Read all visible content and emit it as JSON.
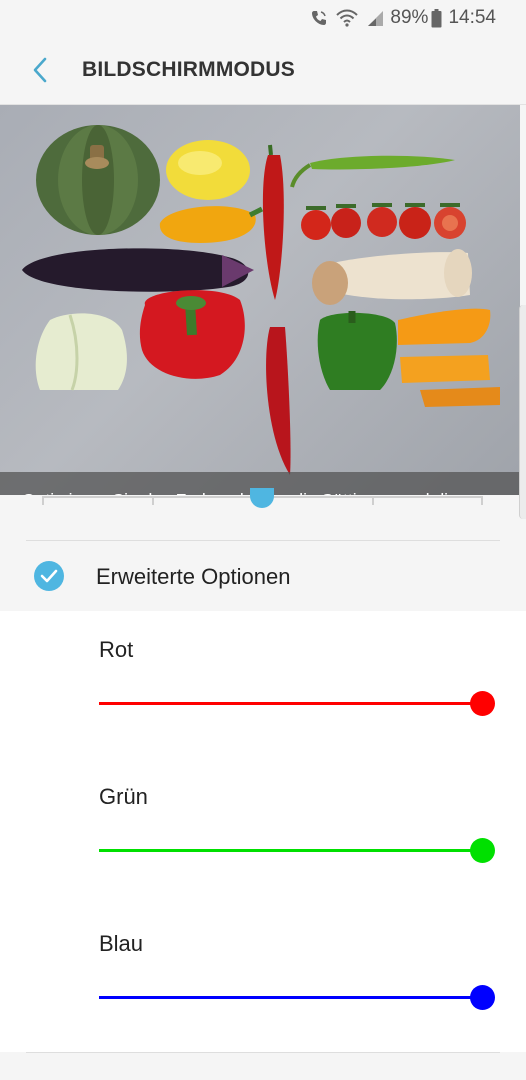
{
  "status_bar": {
    "battery": "89%",
    "time": "14:54",
    "icons": [
      "call-icon",
      "wifi-icon",
      "signal-icon",
      "battery-icon"
    ]
  },
  "header": {
    "title": "BILDSCHIRMMODUS",
    "back_icon": "chevron-left-icon"
  },
  "preview": {
    "description": "Optimieren Sie das Farbspektrum, die Sättigung und die Schärfe Ihrer Anzeige automatisch. Dieser Modus ist möglicherweise nicht mit Apps von Drittanbietern kompatibel."
  },
  "mode_slider": {
    "position": 2,
    "steps": 5,
    "accent": "#4fb6e1"
  },
  "advanced": {
    "label": "Erweiterte Optionen",
    "checked": true
  },
  "color_sliders": [
    {
      "label": "Rot",
      "value": 1.0,
      "color": "#ff0000"
    },
    {
      "label": "Grün",
      "value": 1.0,
      "color": "#00e000"
    },
    {
      "label": "Blau",
      "value": 1.0,
      "color": "#0000ff"
    }
  ]
}
